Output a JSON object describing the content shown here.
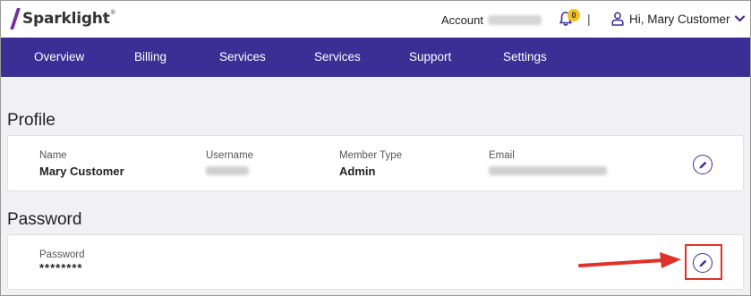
{
  "brand": {
    "name": "Sparklight",
    "reg": "®"
  },
  "header": {
    "account_label": "Account",
    "notification_count": "0",
    "separator": "|",
    "greeting": "Hi, Mary Customer"
  },
  "nav": {
    "items": [
      {
        "label": "Overview"
      },
      {
        "label": "Billing"
      },
      {
        "label": "Services"
      },
      {
        "label": "Services"
      },
      {
        "label": "Support"
      },
      {
        "label": "Settings"
      }
    ]
  },
  "profile": {
    "title": "Profile",
    "name_label": "Name",
    "name_value": "Mary Customer",
    "username_label": "Username",
    "member_type_label": "Member Type",
    "member_type_value": "Admin",
    "email_label": "Email"
  },
  "password": {
    "title": "Password",
    "label": "Password",
    "value": "********"
  },
  "colors": {
    "nav_bg": "#3b2f96",
    "brand_purple": "#7a2f9e",
    "badge": "#f3c11e",
    "annotation_red": "#e0302a"
  }
}
